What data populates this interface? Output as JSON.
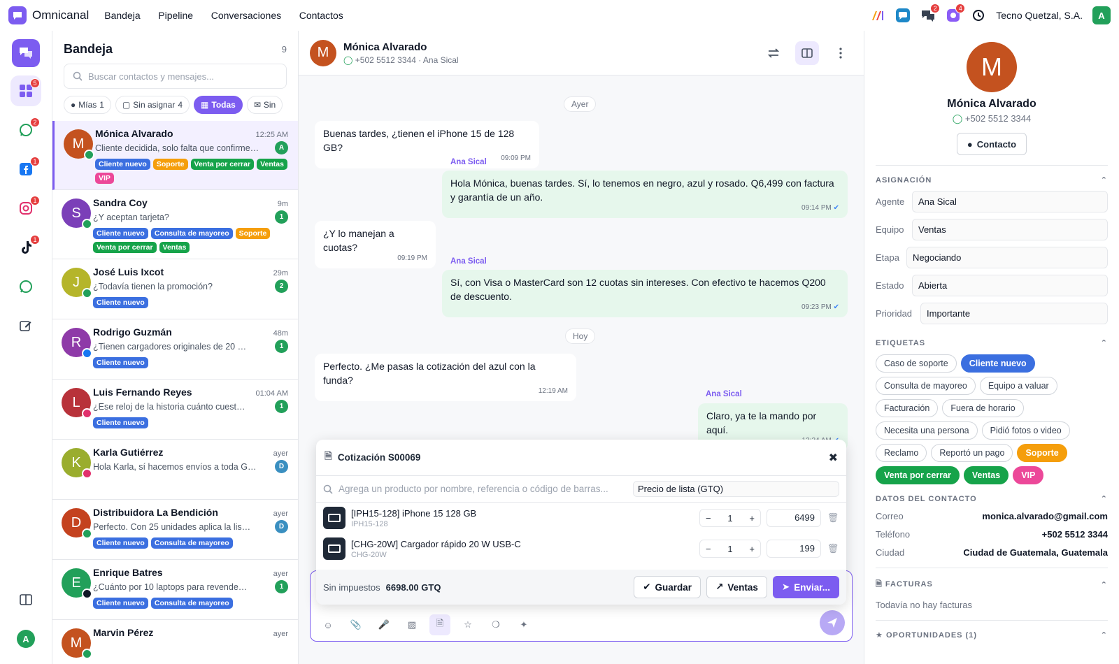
{
  "app": {
    "name": "Omnicanal",
    "company": "Tecno Quetzal, S.A.",
    "avatar_letter": "A",
    "accent": "#7c5cf0"
  },
  "nav": [
    {
      "label": "Bandeja"
    },
    {
      "label": "Pipeline"
    },
    {
      "label": "Conversaciones"
    },
    {
      "label": "Contactos"
    }
  ],
  "top_badges": {
    "chats": "2",
    "apps": "4"
  },
  "sidebar": {
    "badges": {
      "inbox": "5",
      "whatsapp": "2",
      "facebook": "1",
      "instagram": "1",
      "tiktok": "1"
    },
    "avatar_letter": "A"
  },
  "inbox": {
    "title": "Bandeja",
    "count": "9",
    "search_placeholder": "Buscar contactos y mensajes...",
    "filters": [
      {
        "label": "Mías",
        "count": "1"
      },
      {
        "label": "Sin asignar",
        "count": "4"
      },
      {
        "label": "Todas",
        "count": ""
      },
      {
        "label": "Sin",
        "count": ""
      }
    ],
    "conversations": [
      {
        "initial": "M",
        "name": "Mónica Alvarado",
        "time": "12:25 AM",
        "preview": "Cliente decidida, solo falta que confirme…",
        "badge": "A",
        "avatar_color": "#c4521f",
        "channel": "whatsapp",
        "tags": [
          {
            "label": "Cliente nuevo",
            "color": "#3b6fe0"
          },
          {
            "label": "Soporte",
            "color": "#f59e0b"
          },
          {
            "label": "Venta por cerrar",
            "color": "#16a34a"
          },
          {
            "label": "Ventas",
            "color": "#16a34a"
          },
          {
            "label": "VIP",
            "color": "#ec4899"
          }
        ]
      },
      {
        "initial": "S",
        "name": "Sandra Coy",
        "time": "9m",
        "preview": "¿Y aceptan tarjeta?",
        "badge": "1",
        "avatar_color": "#7b3fb8",
        "channel": "whatsapp",
        "tags": [
          {
            "label": "Cliente nuevo",
            "color": "#3b6fe0"
          },
          {
            "label": "Consulta de mayoreo",
            "color": "#3b6fe0"
          },
          {
            "label": "Soporte",
            "color": "#f59e0b"
          },
          {
            "label": "Venta por cerrar",
            "color": "#16a34a"
          },
          {
            "label": "Ventas",
            "color": "#16a34a"
          }
        ]
      },
      {
        "initial": "J",
        "name": "José Luis Ixcot",
        "time": "29m",
        "preview": "¿Todavía tienen la promoción?",
        "badge": "2",
        "avatar_color": "#b5b52a",
        "channel": "whatsapp",
        "tags": [
          {
            "label": "Cliente nuevo",
            "color": "#3b6fe0"
          }
        ]
      },
      {
        "initial": "R",
        "name": "Rodrigo Guzmán",
        "time": "48m",
        "preview": "¿Tienen cargadores originales de 20 …",
        "badge": "1",
        "avatar_color": "#8e3aa8",
        "channel": "facebook",
        "tags": [
          {
            "label": "Cliente nuevo",
            "color": "#3b6fe0"
          }
        ]
      },
      {
        "initial": "L",
        "name": "Luis Fernando Reyes",
        "time": "01:04 AM",
        "preview": "¿Ese reloj de la historia cuánto cuest…",
        "badge": "1",
        "avatar_color": "#b8323a",
        "channel": "instagram",
        "tags": [
          {
            "label": "Cliente nuevo",
            "color": "#3b6fe0"
          }
        ]
      },
      {
        "initial": "K",
        "name": "Karla Gutiérrez",
        "time": "ayer",
        "preview": "Hola Karla, sí hacemos envíos a toda Gu…",
        "badge": "D",
        "avatar_color": "#9aad2e",
        "channel": "instagram",
        "tags": []
      },
      {
        "initial": "D",
        "name": "Distribuidora La Bendición",
        "time": "ayer",
        "preview": "Perfecto. Con 25 unidades aplica la lis…",
        "badge": "D",
        "avatar_color": "#c4421f",
        "channel": "whatsapp",
        "tags": [
          {
            "label": "Cliente nuevo",
            "color": "#3b6fe0"
          },
          {
            "label": "Consulta de mayoreo",
            "color": "#3b6fe0"
          }
        ]
      },
      {
        "initial": "E",
        "name": "Enrique Batres",
        "time": "ayer",
        "preview": "¿Cuánto por 10 laptops para revende…",
        "badge": "1",
        "avatar_color": "#22a05a",
        "channel": "tiktok",
        "tags": [
          {
            "label": "Cliente nuevo",
            "color": "#3b6fe0"
          },
          {
            "label": "Consulta de mayoreo",
            "color": "#3b6fe0"
          }
        ]
      },
      {
        "initial": "M",
        "name": "Marvin Pérez",
        "time": "ayer",
        "preview": "",
        "badge": "",
        "avatar_color": "#c4521f",
        "channel": "whatsapp",
        "tags": []
      }
    ]
  },
  "chat": {
    "contact": {
      "initial": "M",
      "name": "Mónica Alvarado",
      "phone": "+502 5512 3344",
      "agent": "Ana Sical"
    },
    "days": [
      "Ayer",
      "Hoy"
    ],
    "messages": [
      {
        "dir": "in",
        "text": "Buenas tardes, ¿tienen el iPhone 15 de 128 GB?",
        "time": "09:09 PM"
      },
      {
        "dir": "out",
        "sender": "Ana Sical",
        "text": "Hola Mónica, buenas tardes. Sí, lo tenemos en negro, azul y rosado. Q6,499 con factura y garantía de un año.",
        "time": "09:14 PM"
      },
      {
        "dir": "in",
        "text": "¿Y lo manejan a cuotas?",
        "time": "09:19 PM"
      },
      {
        "dir": "out",
        "sender": "Ana Sical",
        "text": "Sí, con Visa o MasterCard son 12 cuotas sin intereses. Con efectivo te hacemos Q200 de descuento.",
        "time": "09:23 PM"
      },
      {
        "dir": "in",
        "text": "Perfecto. ¿Me pasas la cotización del azul con la funda?",
        "time": "12:19 AM"
      },
      {
        "dir": "out",
        "sender": "Ana Sical",
        "text": "Claro, ya te la mando por aquí.",
        "time": "12:24 AM"
      }
    ]
  },
  "quote": {
    "title": "Cotización S00069",
    "search_placeholder": "Agrega un producto por nombre, referencia o código de barras...",
    "pricelist": "Precio de lista (GTQ)",
    "products": [
      {
        "name": "[IPH15-128] iPhone 15 128 GB",
        "ref": "IPH15-128",
        "qty": "1",
        "price": "6499"
      },
      {
        "name": "[CHG-20W] Cargador rápido 20 W USB-C",
        "ref": "CHG-20W",
        "qty": "1",
        "price": "199"
      }
    ],
    "total_label": "Sin impuestos",
    "total": "6698.00 GTQ",
    "save": "Guardar",
    "sales": "Ventas",
    "send": "Enviar..."
  },
  "contact_panel": {
    "initial": "M",
    "name": "Mónica Alvarado",
    "phone": "+502 5512 3344",
    "contact_button": "Contacto",
    "assignment_title": "ASIGNACIÓN",
    "assignment": [
      {
        "label": "Agente",
        "value": "Ana Sical"
      },
      {
        "label": "Equipo",
        "value": "Ventas"
      },
      {
        "label": "Etapa",
        "value": "Negociando"
      },
      {
        "label": "Estado",
        "value": "Abierta"
      },
      {
        "label": "Prioridad",
        "value": "Importante"
      }
    ],
    "tags_title": "ETIQUETAS",
    "tags": [
      {
        "label": "Caso de soporte",
        "active": false,
        "color": ""
      },
      {
        "label": "Cliente nuevo",
        "active": true,
        "color": "#3b6fe0"
      },
      {
        "label": "Consulta de mayoreo",
        "active": false,
        "color": ""
      },
      {
        "label": "Equipo a valuar",
        "active": false,
        "color": ""
      },
      {
        "label": "Facturación",
        "active": false,
        "color": ""
      },
      {
        "label": "Fuera de horario",
        "active": false,
        "color": ""
      },
      {
        "label": "Necesita una persona",
        "active": false,
        "color": ""
      },
      {
        "label": "Pidió fotos o video",
        "active": false,
        "color": ""
      },
      {
        "label": "Reclamo",
        "active": false,
        "color": ""
      },
      {
        "label": "Reportó un pago",
        "active": false,
        "color": ""
      },
      {
        "label": "Soporte",
        "active": true,
        "color": "#f59e0b"
      },
      {
        "label": "Venta por cerrar",
        "active": true,
        "color": "#16a34a"
      },
      {
        "label": "Ventas",
        "active": true,
        "color": "#16a34a"
      },
      {
        "label": "VIP",
        "active": true,
        "color": "#ec4899"
      }
    ],
    "details_title": "DATOS DEL CONTACTO",
    "details": [
      {
        "label": "Correo",
        "value": "monica.alvarado@gmail.com"
      },
      {
        "label": "Teléfono",
        "value": "+502 5512 3344"
      },
      {
        "label": "Ciudad",
        "value": "Ciudad de Guatemala, Guatemala"
      }
    ],
    "invoices_title": "FACTURAS",
    "invoices_empty": "Todavía no hay facturas",
    "opportunities_title": "OPORTUNIDADES (1)"
  }
}
